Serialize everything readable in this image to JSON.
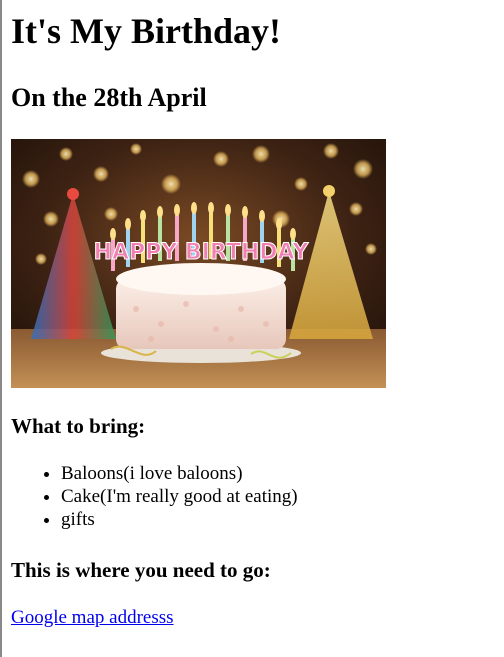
{
  "page": {
    "title": "It's My Birthday!",
    "date_heading": "On the 28th April",
    "photo": {
      "icon": "birthday-cake-photo",
      "caption_text": "HAPPY BIRTHDAY"
    },
    "bring_heading": "What to bring:",
    "bring_items": [
      "Baloons(i love baloons)",
      "Cake(I'm really good at eating)",
      "gifts"
    ],
    "location_heading": "This is where you need to go:",
    "map_link": "Google map addresss"
  },
  "colors": {
    "link": "#0000ee",
    "text": "#000000",
    "background": "#ffffff"
  }
}
